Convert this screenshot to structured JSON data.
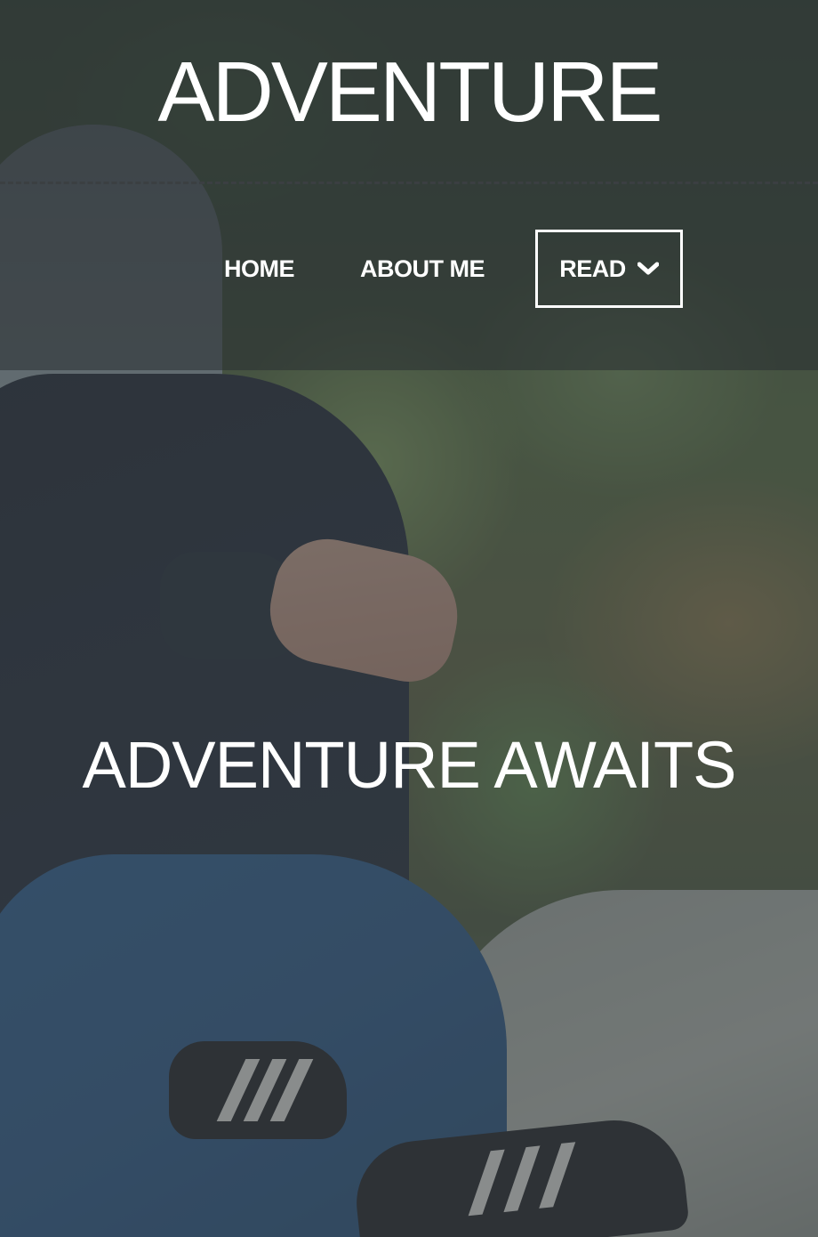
{
  "site": {
    "title": "ADVENTURE"
  },
  "nav": {
    "home_label": "HOME",
    "about_label": "ABOUT ME",
    "read_label": "READ",
    "read_icon": "chevron-down-icon"
  },
  "hero": {
    "headline": "ADVENTURE AWAITS",
    "background": "photo of hooded person sitting on a rock in a forest"
  },
  "colors": {
    "text": "#ffffff",
    "header_overlay": "#282e32",
    "divider": "#3b3f42"
  }
}
